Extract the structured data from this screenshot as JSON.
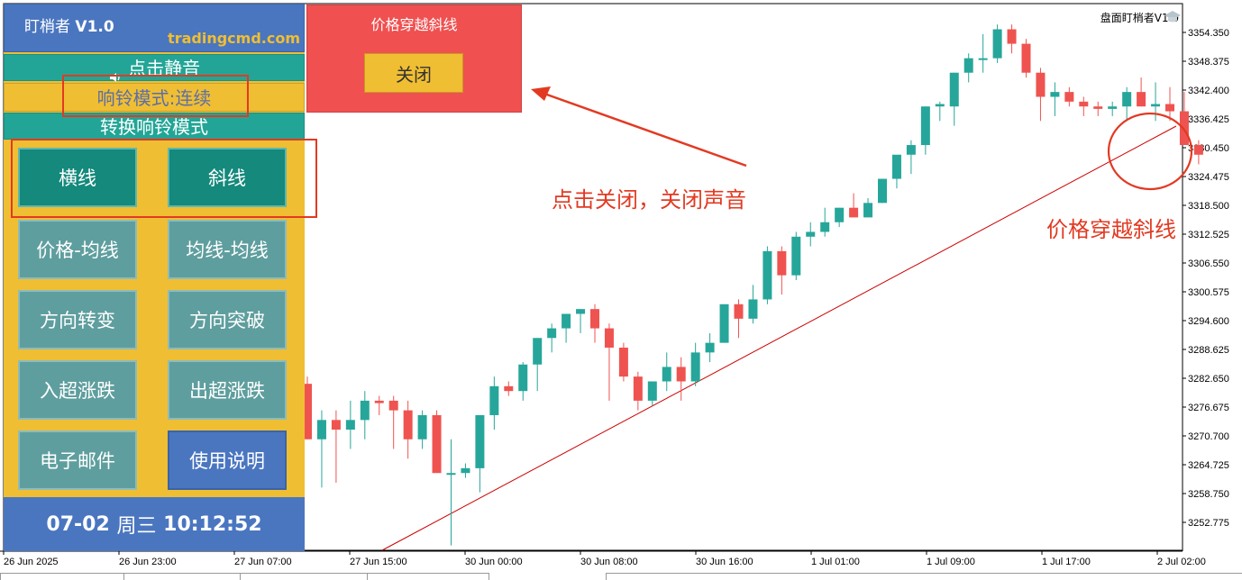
{
  "panel": {
    "title": "盯梢者",
    "version": "V1.0",
    "site": "tradingcmd.com",
    "mute_label": "点击静音",
    "mute_icon": "speaker-icon",
    "mode_label": "响铃模式:连续",
    "switch_label": "转换响铃模式",
    "buttons": [
      {
        "label": "横线"
      },
      {
        "label": "斜线"
      },
      {
        "label": "价格-均线"
      },
      {
        "label": "均线-均线"
      },
      {
        "label": "方向转变"
      },
      {
        "label": "方向突破"
      },
      {
        "label": "入超涨跌"
      },
      {
        "label": "出超涨跌"
      },
      {
        "label": "电子邮件"
      },
      {
        "label": "使用说明"
      }
    ],
    "clock": {
      "date": "07-02",
      "weekday": "周三",
      "time": "10:12:52"
    }
  },
  "alert": {
    "title": "价格穿越斜线",
    "close_label": "关闭"
  },
  "annotations": {
    "click_close": "点击关闭，关闭声音",
    "cross": "价格穿越斜线"
  },
  "chart": {
    "symbol_label": "盘面盯梢者V1.0",
    "price_labels": [
      "3354.350",
      "3348.375",
      "3342.400",
      "3336.425",
      "3330.450",
      "3324.475",
      "3318.500",
      "3312.525",
      "3306.550",
      "3300.575",
      "3294.600",
      "3288.625",
      "3282.650",
      "3276.675",
      "3270.700",
      "3264.725",
      "3258.750",
      "3252.775"
    ],
    "time_labels": [
      "26 Jun 2025",
      "26 Jun 23:00",
      "27 Jun 07:00",
      "27 Jun 15:00",
      "30 Jun 00:00",
      "30 Jun 08:00",
      "30 Jun 16:00",
      "1 Jul 01:00",
      "1 Jul 09:00",
      "1 Jul 17:00",
      "2 Jul 02:00"
    ],
    "colors": {
      "up": "#26a69a",
      "down": "#ef5350",
      "trendline": "#cc0000"
    }
  }
}
